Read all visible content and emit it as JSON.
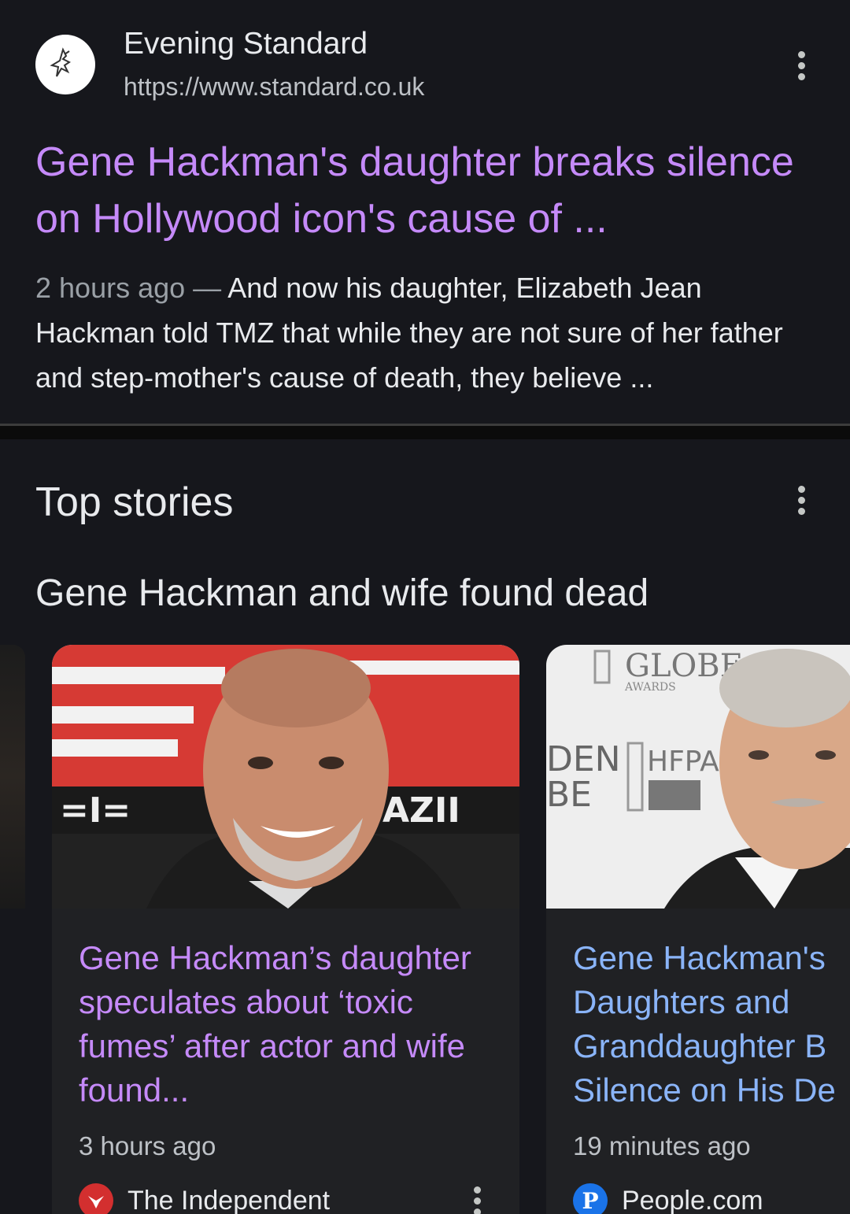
{
  "result": {
    "source_name": "Evening Standard",
    "source_url": "https://www.standard.co.uk",
    "title": "Gene Hackman's daughter breaks silence on Hollywood icon's cause of ...",
    "snippet_date": "2 hours ago",
    "snippet_sep": " — ",
    "snippet_text": "And now his daughter, Elizabeth Jean Hackman told TMZ that while they are not sure of her father and step-mother's cause of death, they believe ..."
  },
  "top_stories": {
    "heading": "Top stories",
    "subheading": "Gene Hackman and wife found dead",
    "cards": [
      {
        "title": "Gene Hackman’s daughter speculates about ‘toxic fumes’ after actor and wife found...",
        "time": "3 hours ago",
        "source": "The Independent",
        "image_sign_text": "AZII"
      },
      {
        "title_lines": [
          "Gene Hackman's",
          "Daughters and",
          "Granddaughter B",
          "Silence on His De"
        ],
        "time": "19 minutes ago",
        "source": "People.com",
        "source_icon_letter": "P",
        "image_sign_text": {
          "globe": "GLOBE",
          "awards": "AWARDS",
          "den": "DEN",
          "be": "BE",
          "hfpa": "HFPA"
        }
      }
    ]
  },
  "colors": {
    "visited_link": "#c58af9",
    "link": "#8ab4f8",
    "background": "#16171c",
    "card": "#202124"
  }
}
